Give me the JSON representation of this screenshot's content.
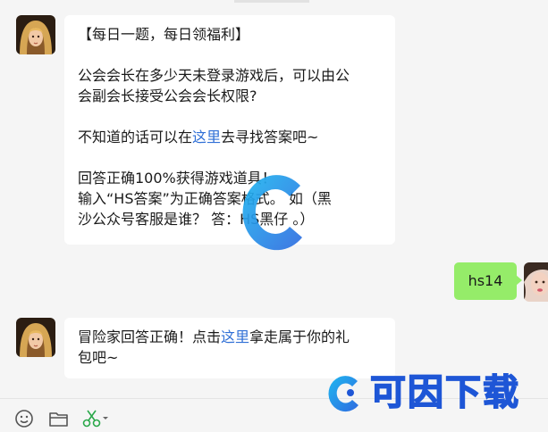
{
  "messages": {
    "first": {
      "title": "【每日一题，每日领福利】",
      "question_line1": "公会会长在多少天未登录游戏后，可以由公",
      "question_line2": "会副会长接受公会会长权限?",
      "hint_before": "不知道的话可以在",
      "hint_link": "这里",
      "hint_after": "去寻找答案吧~",
      "reward_line1": "回答正确100%获得游戏道具！",
      "reward_line2": "输入“HS答案”为正确答案格式。 如（黑",
      "reward_line3": "沙公众号客服是谁？ 答：HS黑仔 。）"
    },
    "reply": {
      "text": "hs14"
    },
    "second": {
      "line1_before": "冒险家回答正确！点击",
      "line1_link": "这里",
      "line1_after": "拿走属于你的礼",
      "line2": "包吧~"
    }
  },
  "watermark": {
    "brand_text": "可因下载"
  },
  "toolbar": {
    "icons": [
      "emoji-icon",
      "folder-icon",
      "scissors-icon"
    ]
  },
  "colors": {
    "self_bubble": "#95ec69",
    "link": "#2f6fd6",
    "brand": "#1e56d6"
  }
}
